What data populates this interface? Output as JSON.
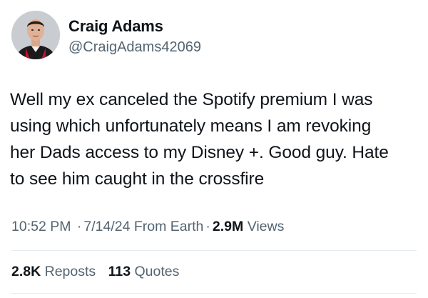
{
  "author": {
    "name": "Craig Adams",
    "handle": "@CraigAdams42069"
  },
  "tweet": {
    "lines": [
      "Well my ex canceled the Spotify premium I was",
      "using which unfortunately means I am revoking",
      "her Dads access to my Disney +.  Good guy. Hate",
      "to see him caught in the crossfire"
    ]
  },
  "meta": {
    "time": "10:52 PM",
    "separator": "·",
    "date": "7/14/24",
    "location": "From Earth",
    "views_count": "2.9M",
    "views_label": "Views"
  },
  "stats": {
    "reposts_count": "2.8K",
    "reposts_label": "Reposts",
    "quotes_count": "113",
    "quotes_label": "Quotes"
  },
  "colors": {
    "text": "#0f1419",
    "secondary": "#536471",
    "divider": "#e6ecf0"
  }
}
